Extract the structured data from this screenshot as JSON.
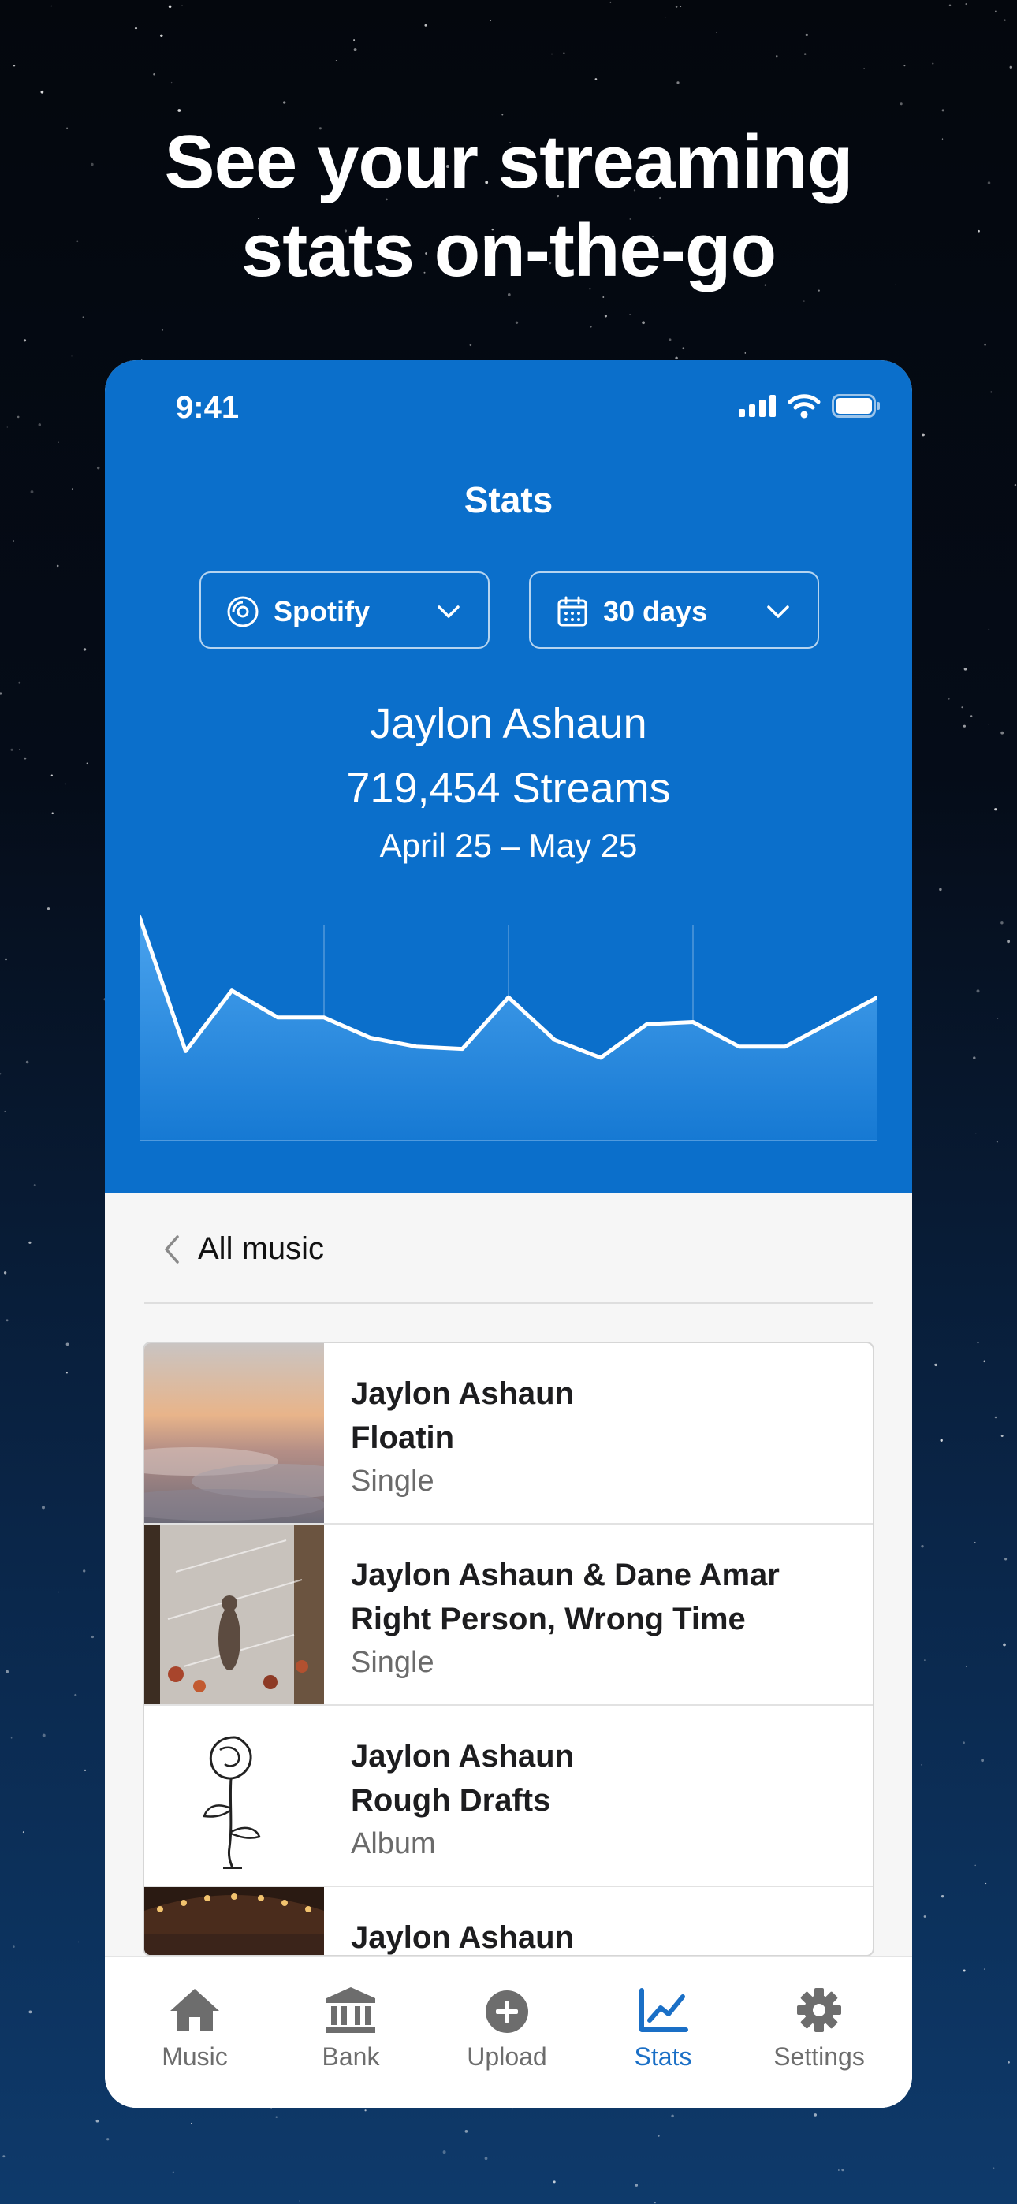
{
  "headline": {
    "line1": "See your streaming",
    "line2": "stats on-the-go"
  },
  "status_bar": {
    "time": "9:41"
  },
  "screen": {
    "title": "Stats",
    "platform_dropdown": {
      "label": "Spotify",
      "icon": "disc-icon"
    },
    "range_dropdown": {
      "label": "30 days",
      "icon": "calendar-icon"
    },
    "artist": "Jaylon Ashaun",
    "streams": "719,454 Streams",
    "date_range": "April 25 – May 25"
  },
  "chart_data": {
    "type": "area",
    "title": "",
    "xlabel": "",
    "ylabel": "",
    "x": [
      1,
      2,
      3,
      4,
      5,
      6,
      7,
      8,
      9,
      10,
      11,
      12,
      13,
      14,
      15,
      16,
      17
    ],
    "values": [
      100,
      40,
      67,
      55,
      55,
      46,
      42,
      41,
      64,
      45,
      37,
      52,
      53,
      42,
      42,
      53,
      64
    ],
    "ylim": [
      0,
      100
    ],
    "grid": "vertical",
    "colors": {
      "line": "#ffffff",
      "fill_top": "#4aa3ee",
      "fill_bottom": "#1679d3"
    }
  },
  "back_nav": {
    "label": "All music"
  },
  "releases": [
    {
      "artist": "Jaylon Ashaun",
      "title": "Floatin",
      "type": "Single",
      "art": "sunset-clouds-artwork"
    },
    {
      "artist": "Jaylon Ashaun & Dane Amar",
      "title": "Right Person, Wrong Time",
      "type": "Single",
      "art": "reflection-artwork"
    },
    {
      "artist": "Jaylon Ashaun",
      "title": "Rough Drafts",
      "type": "Album",
      "art": "rose-sketch-artwork"
    },
    {
      "artist": "Jaylon Ashaun",
      "title": "",
      "type": "",
      "art": "carousel-artwork"
    }
  ],
  "tabs": [
    {
      "label": "Music",
      "icon": "home-icon",
      "active": false
    },
    {
      "label": "Bank",
      "icon": "bank-icon",
      "active": false
    },
    {
      "label": "Upload",
      "icon": "plus-circle-icon",
      "active": false
    },
    {
      "label": "Stats",
      "icon": "chart-icon",
      "active": true
    },
    {
      "label": "Settings",
      "icon": "gear-icon",
      "active": false
    }
  ],
  "colors": {
    "brand_blue": "#0b6fcb",
    "active_tab": "#1a6fc6",
    "inactive_tab": "#6d6d6d"
  }
}
